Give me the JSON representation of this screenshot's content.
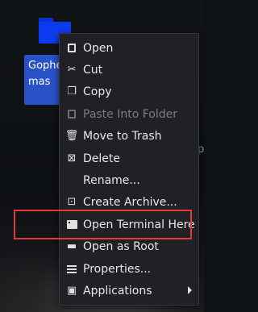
{
  "desktop": {
    "icon_label": "Gophe\nmas",
    "edge_text": "p"
  },
  "context_menu": {
    "items": [
      {
        "label": "Open",
        "icon": "document-open-icon",
        "enabled": true
      },
      {
        "label": "Cut",
        "icon": "scissors-icon",
        "enabled": true
      },
      {
        "label": "Copy",
        "icon": "copy-icon",
        "enabled": true
      },
      {
        "label": "Paste Into Folder",
        "icon": "paste-icon",
        "enabled": false
      },
      {
        "label": "Move to Trash",
        "icon": "trash-icon",
        "enabled": true
      },
      {
        "label": "Delete",
        "icon": "delete-icon",
        "enabled": true
      },
      {
        "label": "Rename...",
        "icon": "",
        "enabled": true
      },
      {
        "label": "Create Archive...",
        "icon": "archive-icon",
        "enabled": true
      },
      {
        "label": "Open Terminal Here",
        "icon": "terminal-icon",
        "enabled": true
      },
      {
        "label": "Open as Root",
        "icon": "folder-icon",
        "enabled": true
      },
      {
        "label": "Properties...",
        "icon": "properties-icon",
        "enabled": true
      },
      {
        "label": "Applications",
        "icon": "applications-icon",
        "enabled": true,
        "submenu": true
      }
    ]
  },
  "colors": {
    "menu_bg": "#1f2124",
    "highlight_border": "#e03a3a",
    "folder_blue": "#0d3cf0"
  }
}
